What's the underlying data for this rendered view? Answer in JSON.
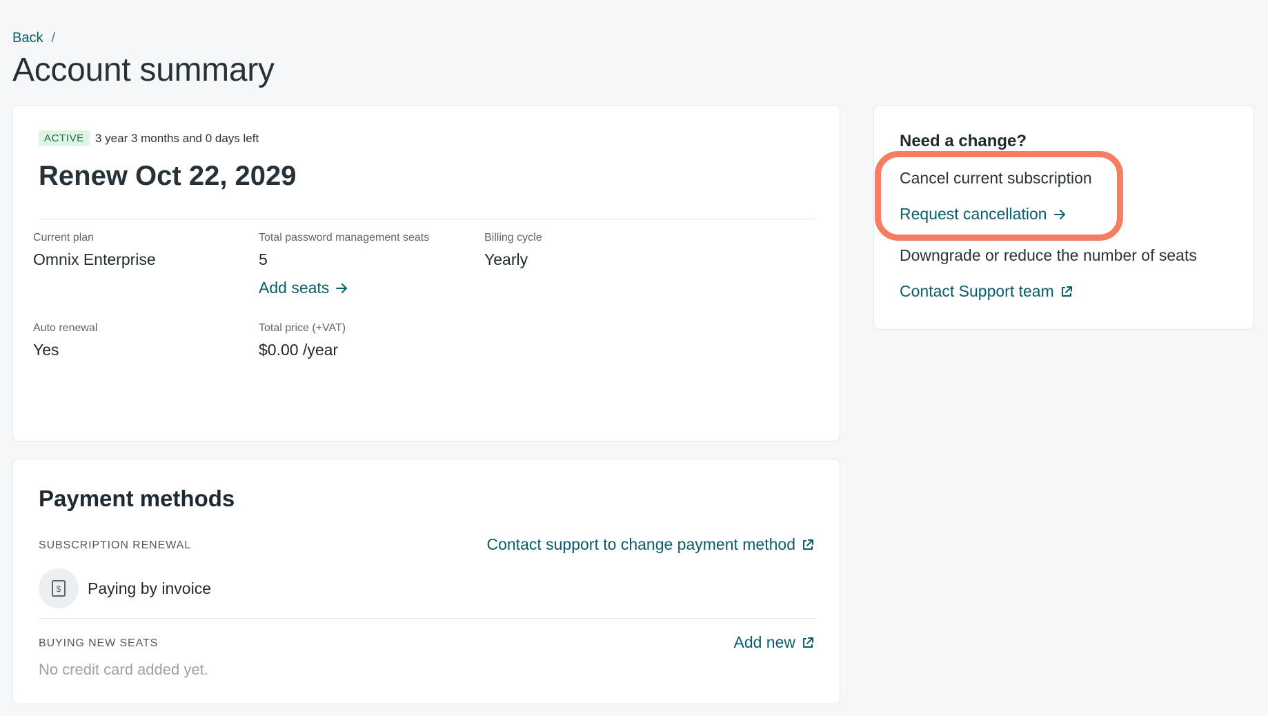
{
  "breadcrumb": {
    "back": "Back",
    "separator": "/"
  },
  "page_title": "Account summary",
  "subscription": {
    "status": "ACTIVE",
    "time_left": "3 year 3 months and 0 days left",
    "renew_title": "Renew Oct 22, 2029",
    "fields": {
      "plan_label": "Current plan",
      "plan_value": "Omnix Enterprise",
      "seats_label": "Total password management seats",
      "seats_value": "5",
      "add_seats": "Add seats",
      "billing_label": "Billing cycle",
      "billing_value": "Yearly",
      "renewal_label": "Auto renewal",
      "renewal_value": "Yes",
      "price_label": "Total price (+VAT)",
      "price_value": "$0.00 /year"
    }
  },
  "payment": {
    "title": "Payment methods",
    "renewal_label": "SUBSCRIPTION RENEWAL",
    "contact_link": "Contact support to change payment method",
    "invoice_text": "Paying by invoice",
    "new_seats_label": "BUYING NEW SEATS",
    "add_new": "Add new",
    "no_card": "No credit card added yet."
  },
  "change": {
    "title": "Need a change?",
    "cancel_text": "Cancel current subscription",
    "request_link": "Request cancellation",
    "downgrade_text": "Downgrade or reduce the number of seats",
    "support_link": "Contact Support team"
  },
  "colors": {
    "link": "#0a5c6b",
    "active_badge_bg": "#dff3e6",
    "active_badge_text": "#1c6b3b",
    "highlight": "#f47d62",
    "background": "#f6f7f8"
  },
  "icons": [
    "arrow-right-icon",
    "external-link-icon",
    "invoice-icon"
  ]
}
